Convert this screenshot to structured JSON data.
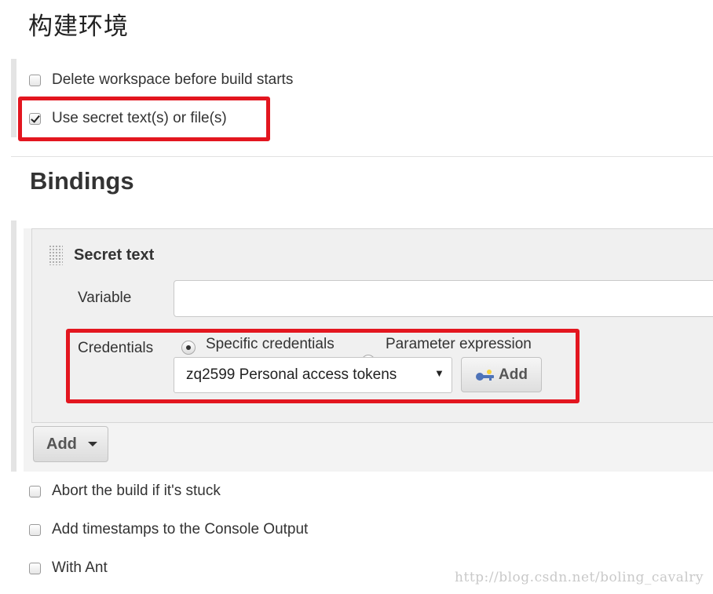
{
  "section": {
    "title": "构建环境"
  },
  "options_top": [
    {
      "label": "Delete workspace before build starts",
      "checked": false
    },
    {
      "label": "Use secret text(s) or file(s)",
      "checked": true
    }
  ],
  "bindings": {
    "title": "Bindings",
    "binding": {
      "type_title": "Secret text",
      "variable_label": "Variable",
      "variable_value": "",
      "credentials_label": "Credentials",
      "radio_specific": "Specific credentials",
      "radio_parameter": "Parameter expression",
      "selected_radio": "Specific credentials",
      "selected_credential": "zq2599 Personal access tokens",
      "add_credential_label": "Add"
    },
    "add_button_label": "Add"
  },
  "options_bottom": [
    {
      "label": "Abort the build if it's stuck",
      "checked": false
    },
    {
      "label": "Add timestamps to the Console Output",
      "checked": false
    },
    {
      "label": "With Ant",
      "checked": false
    }
  ],
  "watermark": "http://blog.csdn.net/boling_cavalry",
  "colors": {
    "highlight": "#e3161f",
    "panel_bg": "#f0f0f0",
    "text": "#333333"
  },
  "icons": [
    "drag-handle-icon",
    "key-icon",
    "caret-down-icon",
    "checkbox-icon",
    "radio-icon"
  ]
}
